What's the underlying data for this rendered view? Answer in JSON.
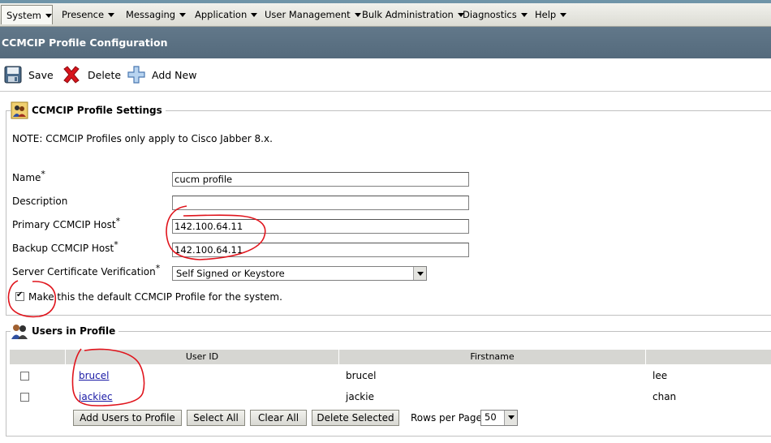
{
  "menu": [
    {
      "label": "System",
      "active": true
    },
    {
      "label": "Presence"
    },
    {
      "label": "Messaging"
    },
    {
      "label": "Application"
    },
    {
      "label": "User Management"
    },
    {
      "label": "Bulk Administration"
    },
    {
      "label": "Diagnostics"
    },
    {
      "label": "Help"
    }
  ],
  "page_title": "CCMCIP Profile Configuration",
  "toolbar": {
    "save_label": "Save",
    "delete_label": "Delete",
    "add_new_label": "Add New"
  },
  "settings": {
    "legend": "CCMCIP Profile Settings",
    "note": "NOTE: CCMCIP Profiles only apply to Cisco Jabber 8.x.",
    "name_label": "Name",
    "name_value": "cucm profile",
    "description_label": "Description",
    "description_value": "",
    "primary_label": "Primary CCMCIP Host",
    "primary_value": "142.100.64.11",
    "backup_label": "Backup CCMCIP Host",
    "backup_value": "142.100.64.11",
    "cert_label": "Server Certificate Verification",
    "cert_value": "Self Signed or Keystore",
    "default_label": "Make this the default CCMCIP Profile for the system.",
    "default_checked": true,
    "required_mark": "*"
  },
  "users": {
    "legend": "Users in Profile",
    "columns": [
      "",
      "User ID",
      "Firstname",
      ""
    ],
    "rows": [
      {
        "user_id": "brucel",
        "firstname": "brucel",
        "lastname": "lee"
      },
      {
        "user_id": "jackiec",
        "firstname": "jackie",
        "lastname": "chan"
      }
    ],
    "buttons": {
      "add_users": "Add Users to Profile",
      "select_all": "Select All",
      "clear_all": "Clear All",
      "delete_selected": "Delete Selected"
    },
    "rows_per_page_label": "Rows per Page",
    "rows_per_page_value": "50"
  },
  "colors": {
    "title_bar": "#5b7183",
    "annotation": "#e0141c",
    "link": "#1a1aa6"
  }
}
